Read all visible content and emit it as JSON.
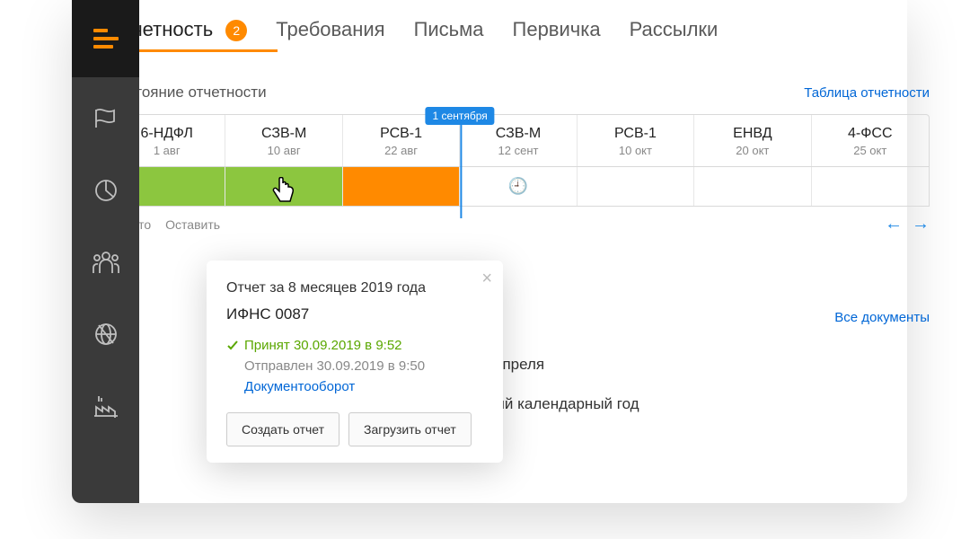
{
  "tabs": {
    "reporting": "Отчетность",
    "reporting_badge": "2",
    "requirements": "Требования",
    "letters": "Письма",
    "primary": "Первичка",
    "mailings": "Рассылки"
  },
  "section": {
    "title": "Состояние отчетности",
    "table_link": "Таблица отчетности"
  },
  "timeline": [
    {
      "name": "6-НДФЛ",
      "date": "1 авг",
      "status": "green"
    },
    {
      "name": "СЗВ-М",
      "date": "10 авг",
      "status": "green"
    },
    {
      "name": "РСВ-1",
      "date": "22 авг",
      "status": "orange"
    },
    {
      "name": "СЗВ-М",
      "date": "12 сент",
      "status": "clock"
    },
    {
      "name": "РСВ-1",
      "date": "10 окт",
      "status": ""
    },
    {
      "name": "ЕНВД",
      "date": "20 окт",
      "status": ""
    },
    {
      "name": "4-ФСС",
      "date": "25 окт",
      "status": ""
    }
  ],
  "marker": {
    "label": "1 сентября"
  },
  "footer_links": {
    "what": "Что это",
    "keep": "Оставить"
  },
  "arrows": {
    "left": "←",
    "right": "→"
  },
  "documents_link": "Все документы",
  "background": {
    "line1": "апреля",
    "line2": "и работников за предшествующий календарный год"
  },
  "popover": {
    "title": "Отчет за 8 месяцев 2019 года",
    "org": "ИФНС 0087",
    "accepted": "Принят 30.09.2019 в 9:52",
    "sent": "Отправлен 30.09.2019 в 9:50",
    "workflow": "Документооборот",
    "create": "Создать отчет",
    "upload": "Загрузить отчет"
  }
}
